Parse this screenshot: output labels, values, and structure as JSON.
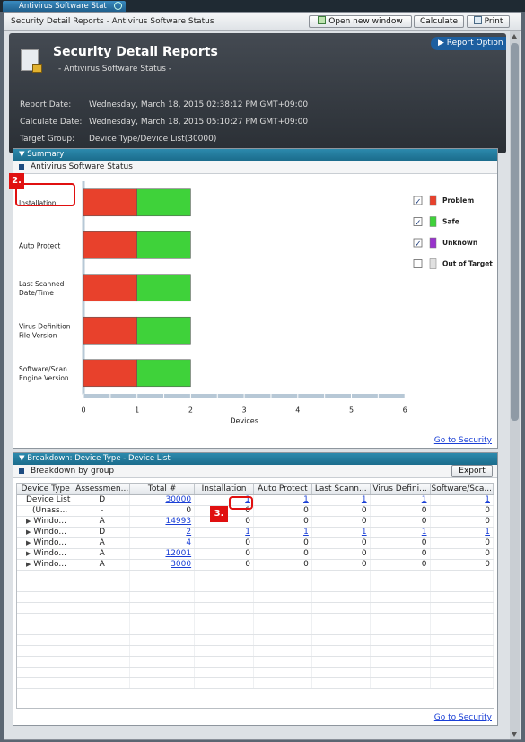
{
  "tab": {
    "label": "Antivirus Software Stat"
  },
  "topbar": {
    "title": "Security Detail Reports - Antivirus Software Status",
    "open_new_window": "Open new window",
    "calculate": "Calculate",
    "print": "Print"
  },
  "header": {
    "title": "Security Detail Reports",
    "subtitle": "- Antivirus Software Status -",
    "report_option": "Report Option",
    "report_date_label": "Report Date:",
    "report_date": "Wednesday, March 18, 2015 02:38:12 PM GMT+09:00",
    "calculate_date_label": "Calculate Date:",
    "calculate_date": "Wednesday, March 18, 2015 05:10:27 PM GMT+09:00",
    "target_group_label": "Target Group:",
    "target_group": "Device Type/Device List(30000)"
  },
  "summary": {
    "panel_title": "Summary",
    "subtitle": "Antivirus Software Status",
    "go_to_security": "Go to Security",
    "step_badge": "2."
  },
  "chart_data": {
    "type": "bar",
    "orientation": "horizontal",
    "stacked": true,
    "categories": [
      "Installation",
      "Auto Protect",
      "Last Scanned Date/Time",
      "Virus Definition File Version",
      "Software/Scan Engine Version"
    ],
    "category_lines": [
      [
        "Installation"
      ],
      [
        "Auto Protect"
      ],
      [
        "Last Scanned",
        "Date/Time"
      ],
      [
        "Virus Definition",
        "File Version"
      ],
      [
        "Software/Scan",
        "Engine Version"
      ]
    ],
    "series": [
      {
        "name": "Problem",
        "color": "#e8412c",
        "values": [
          1,
          1,
          1,
          1,
          1
        ]
      },
      {
        "name": "Safe",
        "color": "#3fd23a",
        "values": [
          1,
          1,
          1,
          1,
          1
        ]
      },
      {
        "name": "Unknown",
        "color": "#9933cc",
        "values": [
          0,
          0,
          0,
          0,
          0
        ]
      },
      {
        "name": "Out of Target",
        "color": "#e0e0e0",
        "values": [
          0,
          0,
          0,
          0,
          0
        ]
      }
    ],
    "legend_checked": [
      true,
      true,
      true,
      false
    ],
    "xlabel": "Devices",
    "xlim": [
      0,
      6
    ],
    "xticks": [
      0,
      1,
      2,
      3,
      4,
      5,
      6
    ],
    "legend_position": "right"
  },
  "breakdown": {
    "panel_title": "Breakdown: Device Type - Device List",
    "subtitle": "Breakdown by group",
    "export": "Export",
    "go_to_security": "Go to Security",
    "step_badge": "3.",
    "columns": [
      "Device Type",
      "Assessmen...",
      "Total #",
      "Installation",
      "Auto Protect",
      "Last Scann...",
      "Virus Defini...",
      "Software/Sca..."
    ],
    "rows": [
      {
        "type": "Device List",
        "expand": "",
        "cells": [
          "D",
          "30000",
          "1",
          "1",
          "1",
          "1",
          "1"
        ],
        "links": [
          1,
          2,
          3,
          4,
          5,
          6
        ]
      },
      {
        "type": "(Unass...",
        "expand": "",
        "cells": [
          "-",
          "0",
          "0",
          "0",
          "0",
          "0",
          "0"
        ],
        "links": []
      },
      {
        "type": "Windo...",
        "expand": "▶",
        "cells": [
          "A",
          "14993",
          "0",
          "0",
          "0",
          "0",
          "0"
        ],
        "links": [
          1
        ]
      },
      {
        "type": "Windo...",
        "expand": "▶",
        "cells": [
          "D",
          "2",
          "1",
          "1",
          "1",
          "1",
          "1"
        ],
        "links": [
          1,
          2,
          3,
          4,
          5,
          6
        ]
      },
      {
        "type": "Windo...",
        "expand": "▶",
        "cells": [
          "A",
          "4",
          "0",
          "0",
          "0",
          "0",
          "0"
        ],
        "links": [
          1
        ]
      },
      {
        "type": "Windo...",
        "expand": "▶",
        "cells": [
          "A",
          "12001",
          "0",
          "0",
          "0",
          "0",
          "0"
        ],
        "links": [
          1
        ]
      },
      {
        "type": "Windo...",
        "expand": "▶",
        "cells": [
          "A",
          "3000",
          "0",
          "0",
          "0",
          "0",
          "0"
        ],
        "links": [
          1
        ]
      }
    ]
  }
}
